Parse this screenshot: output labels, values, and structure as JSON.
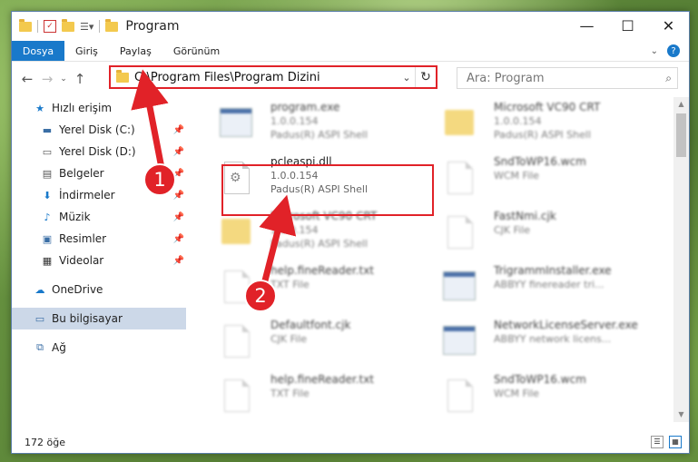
{
  "window": {
    "title": "Program",
    "controls": [
      "—",
      "☐",
      "✕"
    ]
  },
  "ribbon": {
    "tabs": [
      "Dosya",
      "Giriş",
      "Paylaş",
      "Görünüm"
    ],
    "help": "?"
  },
  "address": {
    "path": "C:\\Program Files\\Program Dizini"
  },
  "search": {
    "placeholder": "Ara: Program"
  },
  "sidebar": {
    "items": [
      {
        "label": "Hızlı erişim",
        "icon": "star-icon"
      },
      {
        "label": "Yerel Disk (C:)",
        "icon": "drive-icon"
      },
      {
        "label": "Yerel Disk (D:)",
        "icon": "drive-icon"
      },
      {
        "label": "Belgeler",
        "icon": "documents-icon"
      },
      {
        "label": "İndirmeler",
        "icon": "download-icon"
      },
      {
        "label": "Müzik",
        "icon": "music-icon"
      },
      {
        "label": "Resimler",
        "icon": "pictures-icon"
      },
      {
        "label": "Videolar",
        "icon": "video-icon"
      },
      {
        "label": "OneDrive",
        "icon": "cloud-icon"
      },
      {
        "label": "Bu bilgisayar",
        "icon": "computer-icon"
      },
      {
        "label": "Ağ",
        "icon": "network-icon"
      }
    ]
  },
  "files": [
    {
      "name": "program.exe",
      "sub1": "1.0.0.154",
      "sub2": "Padus(R) ASPI Shell"
    },
    {
      "name": "Microsoft VC90 CRT",
      "sub1": "1.0.0.154",
      "sub2": "Padus(R) ASPI Shell"
    },
    {
      "name": "pcleaspi.dll",
      "sub1": "1.0.0.154",
      "sub2": "Padus(R) ASPI Shell"
    },
    {
      "name": "SndToWP16.wcm",
      "sub1": "WCM File",
      "sub2": ""
    },
    {
      "name": "Microsoft VC90 CRT",
      "sub1": "1.0.0.154",
      "sub2": "Padus(R) ASPI Shell"
    },
    {
      "name": "FastNmi.cjk",
      "sub1": "CJK File",
      "sub2": ""
    },
    {
      "name": "help.fineReader.txt",
      "sub1": "TXT File",
      "sub2": ""
    },
    {
      "name": "TrigrammInstaller.exe",
      "sub1": "ABBYY finereader tri...",
      "sub2": ""
    },
    {
      "name": "Defaultfont.cjk",
      "sub1": "CJK File",
      "sub2": ""
    },
    {
      "name": "NetworkLicenseServer.exe",
      "sub1": "ABBYY network licens...",
      "sub2": ""
    },
    {
      "name": "help.fineReader.txt",
      "sub1": "TXT File",
      "sub2": ""
    },
    {
      "name": "SndToWP16.wcm",
      "sub1": "WCM File",
      "sub2": ""
    }
  ],
  "status": {
    "count": "172 öğe"
  },
  "badges": {
    "one": "1",
    "two": "2"
  },
  "colors": {
    "accent": "#1979ca",
    "annotation": "#e12228"
  }
}
